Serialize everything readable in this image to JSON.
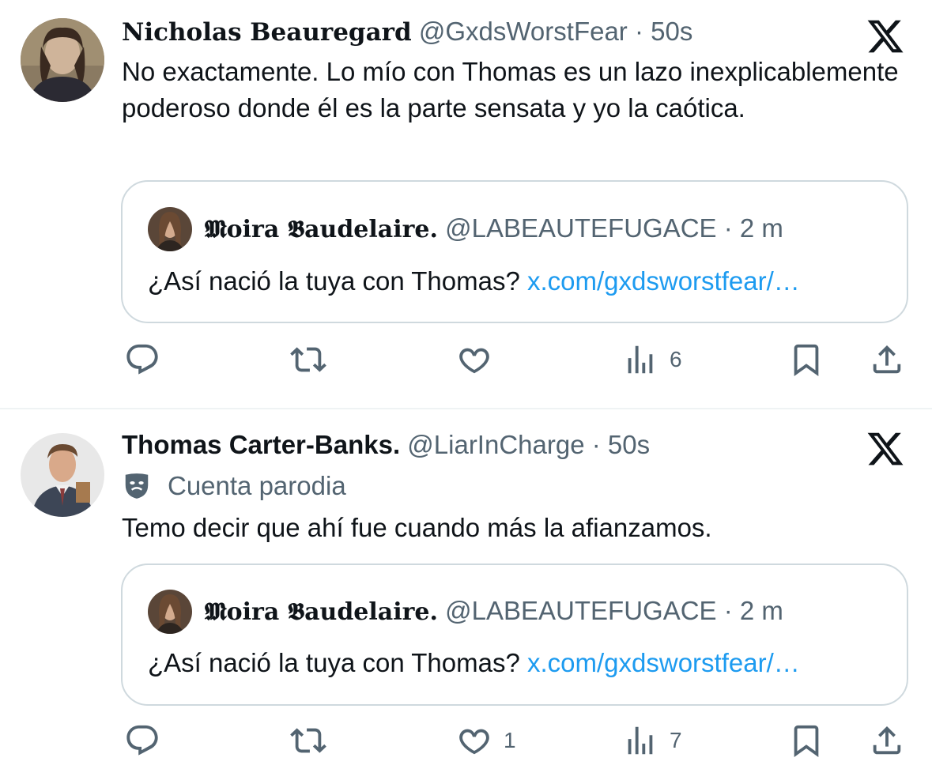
{
  "tweets": [
    {
      "author": {
        "name": "Nicholas Beauregard",
        "handle": "@GxdsWorstFear",
        "separator": "·",
        "time": "50s"
      },
      "text": "No exactamente. Lo mío con Thomas es un lazo inexplicablemente poderoso donde él es la parte sensata y yo la caótica.",
      "quote": {
        "name": "𝕸oira 𝕭audelaire.",
        "handle": "@LABEAUTEFUGACE",
        "separator": "·",
        "time": "2 m",
        "text": "¿Así nació la tuya con Thomas?",
        "link": "x.com/gxdsworstfear/…"
      },
      "stats": {
        "likes": "",
        "views": "6"
      }
    },
    {
      "author": {
        "name": "Thomas Carter-Banks.",
        "handle": "@LiarInCharge",
        "separator": "·",
        "time": "50s",
        "label": "Cuenta parodia"
      },
      "text": "Temo decir que ahí fue cuando más la afianzamos.",
      "quote": {
        "name": "𝕸oira 𝕭audelaire.",
        "handle": "@LABEAUTEFUGACE",
        "separator": "·",
        "time": "2 m",
        "text": "¿Así nació la tuya con Thomas?",
        "link": "x.com/gxdsworstfear/…"
      },
      "stats": {
        "likes": "1",
        "views": "7"
      }
    }
  ],
  "icons": {
    "brand": "x-logo-icon",
    "reply": "reply-icon",
    "retweet": "retweet-icon",
    "like": "heart-icon",
    "views": "views-icon",
    "bookmark": "bookmark-icon",
    "share": "share-icon",
    "parody": "theater-mask-icon"
  },
  "colors": {
    "text": "#0f1419",
    "secondary": "#536471",
    "link": "#1d9bf0",
    "border": "#cfd9de"
  }
}
